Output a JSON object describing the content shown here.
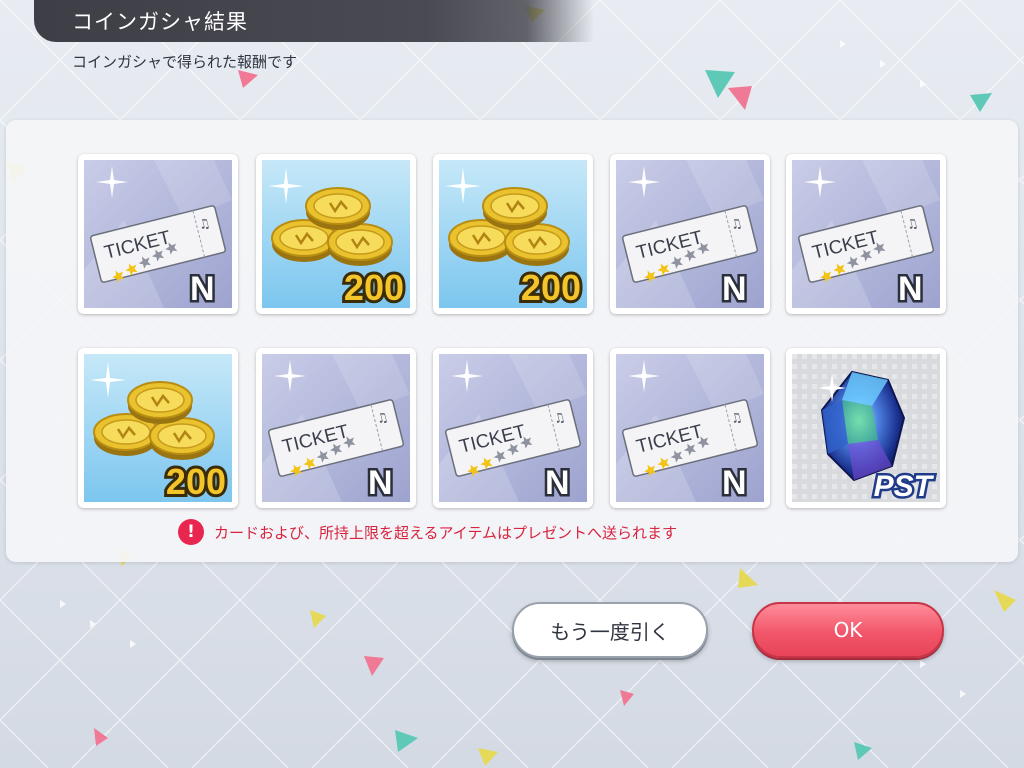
{
  "header": {
    "title": "コインガシャ結果",
    "subtitle": "コインガシャで得られた報酬です"
  },
  "items": [
    {
      "type": "ticket",
      "ticket_text": "TICKET",
      "rank": "N",
      "stars_filled": 2,
      "stars_total": 5
    },
    {
      "type": "coin",
      "amount": "200"
    },
    {
      "type": "coin",
      "amount": "200"
    },
    {
      "type": "ticket",
      "ticket_text": "TICKET",
      "rank": "N",
      "stars_filled": 2,
      "stars_total": 5
    },
    {
      "type": "ticket",
      "ticket_text": "TICKET",
      "rank": "N",
      "stars_filled": 2,
      "stars_total": 5
    },
    {
      "type": "coin",
      "amount": "200"
    },
    {
      "type": "ticket",
      "ticket_text": "TICKET",
      "rank": "N",
      "stars_filled": 2,
      "stars_total": 5
    },
    {
      "type": "ticket",
      "ticket_text": "TICKET",
      "rank": "N",
      "stars_filled": 2,
      "stars_total": 5
    },
    {
      "type": "ticket",
      "ticket_text": "TICKET",
      "rank": "N",
      "stars_filled": 2,
      "stars_total": 5
    },
    {
      "type": "jewel",
      "label": "PST"
    }
  ],
  "notice": {
    "icon": "exclamation-icon",
    "text": "カードおよび、所持上限を超えるアイテムはプレゼントへ送られます"
  },
  "buttons": {
    "again_label": "もう一度引く",
    "ok_label": "OK"
  },
  "colors": {
    "accent_red": "#e8264f",
    "ok_button": "#f2566a",
    "header_bg": "#3e3e46"
  }
}
